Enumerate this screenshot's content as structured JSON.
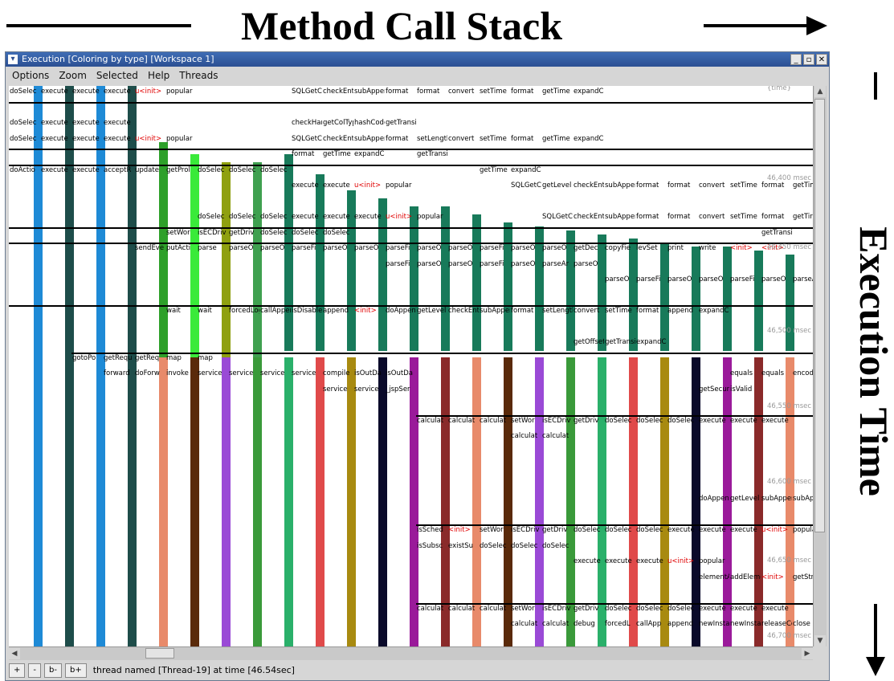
{
  "annotations": {
    "top_label": "Method Call Stack",
    "side_label": "Execution Time"
  },
  "window": {
    "title": "Execution  [Coloring by type] [Workspace 1]",
    "controls": [
      "_",
      "▫",
      "✕"
    ]
  },
  "menu": [
    "Options",
    "Zoom",
    "Selected",
    "Help",
    "Threads"
  ],
  "status": {
    "buttons": [
      "+",
      "-",
      "b-",
      "b+"
    ],
    "text": "thread named [Thread-19] at time [46.54sec]"
  },
  "time_labels": [
    "{time}",
    "46,400 msec",
    "46,450 msec",
    "46,500 msec",
    "46,550 msec",
    "46,600 msec",
    "46,650 msec",
    "46,700 msec"
  ],
  "columns": [
    {
      "color": "#1e8ad6",
      "segments": [
        [
          0,
          698
        ]
      ]
    },
    {
      "color": "#1e4d4a",
      "segments": [
        [
          0,
          698
        ]
      ]
    },
    {
      "color": "#1e8ad6",
      "segments": [
        [
          0,
          698
        ]
      ]
    },
    {
      "color": "#1e4d4a",
      "segments": [
        [
          0,
          698
        ]
      ]
    },
    {
      "color": "#2ea02a",
      "segments": [
        [
          70,
          698
        ]
      ]
    },
    {
      "color": "#3aea3a",
      "segments": [
        [
          85,
          698
        ]
      ]
    },
    {
      "color": "#8fa010",
      "segments": [
        [
          95,
          698
        ]
      ]
    },
    {
      "color": "#3fa050",
      "segments": [
        [
          95,
          400
        ]
      ]
    },
    {
      "color": "#187a5a",
      "segments": [
        [
          85,
          330
        ]
      ]
    },
    {
      "color": "#187a5a",
      "segments": [
        [
          110,
          330
        ]
      ]
    },
    {
      "color": "#187a5a",
      "segments": [
        [
          130,
          330
        ]
      ]
    },
    {
      "color": "#187a5a",
      "segments": [
        [
          140,
          330
        ]
      ]
    },
    {
      "color": "#187a5a",
      "segments": [
        [
          150,
          330
        ]
      ]
    },
    {
      "color": "#187a5a",
      "segments": [
        [
          150,
          330
        ]
      ]
    },
    {
      "color": "#187a5a",
      "segments": [
        [
          160,
          330
        ]
      ]
    },
    {
      "color": "#187a5a",
      "segments": [
        [
          170,
          330
        ]
      ]
    },
    {
      "color": "#187a5a",
      "segments": [
        [
          175,
          330
        ]
      ]
    },
    {
      "color": "#187a5a",
      "segments": [
        [
          180,
          330
        ]
      ]
    },
    {
      "color": "#187a5a",
      "segments": [
        [
          185,
          330
        ]
      ]
    },
    {
      "color": "#187a5a",
      "segments": [
        [
          190,
          330
        ]
      ]
    },
    {
      "color": "#187a5a",
      "segments": [
        [
          195,
          330
        ]
      ]
    },
    {
      "color": "#187a5a",
      "segments": [
        [
          200,
          330
        ]
      ]
    },
    {
      "color": "#187a5a",
      "segments": [
        [
          200,
          330
        ]
      ]
    },
    {
      "color": "#187a5a",
      "segments": [
        [
          205,
          330
        ]
      ]
    },
    {
      "color": "#187a5a",
      "segments": [
        [
          210,
          330
        ]
      ]
    }
  ],
  "labels": [
    {
      "t": "doSelec",
      "c": 0,
      "r": 0
    },
    {
      "t": "execute",
      "c": 1,
      "r": 0
    },
    {
      "t": "execute",
      "c": 2,
      "r": 0
    },
    {
      "t": "execute",
      "c": 3,
      "r": 0
    },
    {
      "t": "u<init>",
      "c": 4,
      "r": 0,
      "red": true
    },
    {
      "t": "popular",
      "c": 5,
      "r": 0
    },
    {
      "t": "SQLGetCol",
      "c": 9,
      "r": 0
    },
    {
      "t": "checkEntr",
      "c": 10,
      "r": 0
    },
    {
      "t": "subAppend",
      "c": 11,
      "r": 0
    },
    {
      "t": "format",
      "c": 12,
      "r": 0
    },
    {
      "t": "format",
      "c": 13,
      "r": 0
    },
    {
      "t": "convert",
      "c": 14,
      "r": 0
    },
    {
      "t": "setTime",
      "c": 15,
      "r": 0
    },
    {
      "t": "format",
      "c": 16,
      "r": 0
    },
    {
      "t": "getTime",
      "c": 17,
      "r": 0
    },
    {
      "t": "expandCaget",
      "c": 18,
      "r": 0
    },
    {
      "t": "doSelec",
      "c": 0,
      "r": 2
    },
    {
      "t": "execute",
      "c": 1,
      "r": 2
    },
    {
      "t": "execute",
      "c": 2,
      "r": 2
    },
    {
      "t": "execute",
      "c": 3,
      "r": 2
    },
    {
      "t": "checkHan",
      "c": 9,
      "r": 2
    },
    {
      "t": "getColTyp",
      "c": 10,
      "r": 2
    },
    {
      "t": "hashCode",
      "c": 11,
      "r": 2
    },
    {
      "t": "getTransi",
      "c": 12,
      "r": 2
    },
    {
      "t": "doSelec",
      "c": 0,
      "r": 3
    },
    {
      "t": "execute",
      "c": 1,
      "r": 3
    },
    {
      "t": "execute",
      "c": 2,
      "r": 3
    },
    {
      "t": "execute",
      "c": 3,
      "r": 3
    },
    {
      "t": "u<init>",
      "c": 4,
      "r": 3,
      "red": true
    },
    {
      "t": "popular",
      "c": 5,
      "r": 3
    },
    {
      "t": "SQLGetCol",
      "c": 9,
      "r": 3
    },
    {
      "t": "checkEntr",
      "c": 10,
      "r": 3
    },
    {
      "t": "subAppend",
      "c": 11,
      "r": 3
    },
    {
      "t": "format",
      "c": 12,
      "r": 3
    },
    {
      "t": "setLength",
      "c": 13,
      "r": 3
    },
    {
      "t": "convert",
      "c": 14,
      "r": 3
    },
    {
      "t": "setTime",
      "c": 15,
      "r": 3
    },
    {
      "t": "format",
      "c": 16,
      "r": 3
    },
    {
      "t": "getTime",
      "c": 17,
      "r": 3
    },
    {
      "t": "expandCaget",
      "c": 18,
      "r": 3
    },
    {
      "t": "format",
      "c": 9,
      "r": 4
    },
    {
      "t": "getTime",
      "c": 10,
      "r": 4
    },
    {
      "t": "expandCaget",
      "c": 11,
      "r": 4
    },
    {
      "t": "getTransi",
      "c": 13,
      "r": 4
    },
    {
      "t": "doActio",
      "c": 0,
      "r": 5
    },
    {
      "t": "execute",
      "c": 1,
      "r": 5
    },
    {
      "t": "execute",
      "c": 2,
      "r": 5
    },
    {
      "t": "acceptR",
      "c": 3,
      "r": 5
    },
    {
      "t": "update",
      "c": 4,
      "r": 5
    },
    {
      "t": "getProl",
      "c": 5,
      "r": 5
    },
    {
      "t": "doSelec",
      "c": 6,
      "r": 5
    },
    {
      "t": "doSelec",
      "c": 7,
      "r": 5
    },
    {
      "t": "doSelec",
      "c": 8,
      "r": 5
    },
    {
      "t": "getTime",
      "c": 15,
      "r": 5
    },
    {
      "t": "expandCaget",
      "c": 16,
      "r": 5
    },
    {
      "t": "execute",
      "c": 9,
      "r": 6
    },
    {
      "t": "execute",
      "c": 10,
      "r": 6
    },
    {
      "t": "u<init>",
      "c": 11,
      "r": 6,
      "red": true
    },
    {
      "t": "popular",
      "c": 12,
      "r": 6
    },
    {
      "t": "SQLGetCol",
      "c": 16,
      "r": 6
    },
    {
      "t": "getLevel",
      "c": 17,
      "r": 6
    },
    {
      "t": "checkEntr",
      "c": 18,
      "r": 6
    },
    {
      "t": "subAppend",
      "c": 19,
      "r": 6
    },
    {
      "t": "format",
      "c": 20,
      "r": 6
    },
    {
      "t": "format",
      "c": 21,
      "r": 6
    },
    {
      "t": "convert",
      "c": 22,
      "r": 6
    },
    {
      "t": "setTime",
      "c": 23,
      "r": 6
    },
    {
      "t": "format",
      "c": 24,
      "r": 6
    },
    {
      "t": "getTim",
      "c": 25,
      "r": 6
    },
    {
      "t": "doSelec",
      "c": 6,
      "r": 8
    },
    {
      "t": "doSelec",
      "c": 7,
      "r": 8
    },
    {
      "t": "doSelec",
      "c": 8,
      "r": 8
    },
    {
      "t": "execute",
      "c": 9,
      "r": 8
    },
    {
      "t": "execute",
      "c": 10,
      "r": 8
    },
    {
      "t": "execute",
      "c": 11,
      "r": 8
    },
    {
      "t": "u<init>",
      "c": 12,
      "r": 8,
      "red": true
    },
    {
      "t": "popular",
      "c": 13,
      "r": 8
    },
    {
      "t": "SQLGetCol",
      "c": 17,
      "r": 8
    },
    {
      "t": "checkEntr",
      "c": 18,
      "r": 8
    },
    {
      "t": "subAppend",
      "c": 19,
      "r": 8
    },
    {
      "t": "format",
      "c": 20,
      "r": 8
    },
    {
      "t": "format",
      "c": 21,
      "r": 8
    },
    {
      "t": "convert",
      "c": 22,
      "r": 8
    },
    {
      "t": "setTime",
      "c": 23,
      "r": 8
    },
    {
      "t": "format",
      "c": 24,
      "r": 8
    },
    {
      "t": "getTir",
      "c": 25,
      "r": 8
    },
    {
      "t": "setWor",
      "c": 5,
      "r": 9
    },
    {
      "t": "isECDriv",
      "c": 6,
      "r": 9
    },
    {
      "t": "getDriv",
      "c": 7,
      "r": 9
    },
    {
      "t": "doSelec",
      "c": 8,
      "r": 9
    },
    {
      "t": "doSelec",
      "c": 9,
      "r": 9
    },
    {
      "t": "doSelec",
      "c": 10,
      "r": 9
    },
    {
      "t": "getTransi",
      "c": 24,
      "r": 9
    },
    {
      "t": "sendEve",
      "c": 4,
      "r": 10
    },
    {
      "t": "putActi",
      "c": 5,
      "r": 10
    },
    {
      "t": "parse",
      "c": 6,
      "r": 10
    },
    {
      "t": "parseO",
      "c": 7,
      "r": 10
    },
    {
      "t": "parseO",
      "c": 8,
      "r": 10
    },
    {
      "t": "parseFi",
      "c": 9,
      "r": 10
    },
    {
      "t": "parseO",
      "c": 10,
      "r": 10
    },
    {
      "t": "parseO",
      "c": 11,
      "r": 10
    },
    {
      "t": "parseFi",
      "c": 12,
      "r": 10
    },
    {
      "t": "parseO",
      "c": 13,
      "r": 10
    },
    {
      "t": "parseO",
      "c": 14,
      "r": 10
    },
    {
      "t": "parseFi",
      "c": 15,
      "r": 10
    },
    {
      "t": "parseO",
      "c": 16,
      "r": 10
    },
    {
      "t": "parseO",
      "c": 17,
      "r": 10
    },
    {
      "t": "getDec",
      "c": 18,
      "r": 10
    },
    {
      "t": "copyFie",
      "c": 19,
      "r": 10
    },
    {
      "t": "levSet",
      "c": 20,
      "r": 10
    },
    {
      "t": "print",
      "c": 21,
      "r": 10
    },
    {
      "t": "write",
      "c": 22,
      "r": 10
    },
    {
      "t": "<init>",
      "c": 23,
      "r": 10,
      "red": true
    },
    {
      "t": "<init>",
      "c": 24,
      "r": 10,
      "red": true
    },
    {
      "t": "parseFi",
      "c": 12,
      "r": 11
    },
    {
      "t": "parseO",
      "c": 13,
      "r": 11
    },
    {
      "t": "parseO",
      "c": 14,
      "r": 11
    },
    {
      "t": "parseFi",
      "c": 15,
      "r": 11
    },
    {
      "t": "parseO",
      "c": 16,
      "r": 11
    },
    {
      "t": "parseAr",
      "c": 17,
      "r": 11
    },
    {
      "t": "parseO",
      "c": 18,
      "r": 11
    },
    {
      "t": "parseO",
      "c": 19,
      "r": 12
    },
    {
      "t": "parseFi",
      "c": 20,
      "r": 12
    },
    {
      "t": "parseO",
      "c": 21,
      "r": 12
    },
    {
      "t": "parseO",
      "c": 22,
      "r": 12
    },
    {
      "t": "parseFi",
      "c": 23,
      "r": 12
    },
    {
      "t": "parseO",
      "c": 24,
      "r": 12
    },
    {
      "t": "parseA",
      "c": 25,
      "r": 12
    },
    {
      "t": "wait",
      "c": 5,
      "r": 14
    },
    {
      "t": "wait",
      "c": 6,
      "r": 14
    },
    {
      "t": "forcedLog",
      "c": 7,
      "r": 14
    },
    {
      "t": "callAppen",
      "c": 8,
      "r": 14
    },
    {
      "t": "isDisable",
      "c": 9,
      "r": 14
    },
    {
      "t": "append",
      "c": 10,
      "r": 14
    },
    {
      "t": "<init>",
      "c": 11,
      "r": 14,
      "red": true
    },
    {
      "t": "doAppend",
      "c": 12,
      "r": 14
    },
    {
      "t": "getLevel",
      "c": 13,
      "r": 14
    },
    {
      "t": "checkEntr",
      "c": 14,
      "r": 14
    },
    {
      "t": "subAppend",
      "c": 15,
      "r": 14
    },
    {
      "t": "format",
      "c": 16,
      "r": 14
    },
    {
      "t": "setLength",
      "c": 17,
      "r": 14
    },
    {
      "t": "convert",
      "c": 18,
      "r": 14
    },
    {
      "t": "setTime",
      "c": 19,
      "r": 14
    },
    {
      "t": "format",
      "c": 20,
      "r": 14
    },
    {
      "t": "append",
      "c": 21,
      "r": 14
    },
    {
      "t": "expandCaget",
      "c": 22,
      "r": 14
    },
    {
      "t": "getOffset",
      "c": 18,
      "r": 16
    },
    {
      "t": "getTransi",
      "c": 19,
      "r": 16
    },
    {
      "t": "expandCaget",
      "c": 20,
      "r": 16
    },
    {
      "t": "gotoPo",
      "c": 2,
      "r": 17
    },
    {
      "t": "getRequ",
      "c": 3,
      "r": 17
    },
    {
      "t": "getReq",
      "c": 4,
      "r": 17
    },
    {
      "t": "map",
      "c": 5,
      "r": 17
    },
    {
      "t": "map",
      "c": 6,
      "r": 17
    },
    {
      "t": "forward",
      "c": 3,
      "r": 18
    },
    {
      "t": "doForw",
      "c": 4,
      "r": 18
    },
    {
      "t": "invoke",
      "c": 5,
      "r": 18
    },
    {
      "t": "service",
      "c": 6,
      "r": 18
    },
    {
      "t": "service",
      "c": 7,
      "r": 18
    },
    {
      "t": "service",
      "c": 8,
      "r": 18
    },
    {
      "t": "service",
      "c": 9,
      "r": 18
    },
    {
      "t": "compile",
      "c": 10,
      "r": 18
    },
    {
      "t": "isOutDa",
      "c": 11,
      "r": 18
    },
    {
      "t": "isOutDa",
      "c": 12,
      "r": 18
    },
    {
      "t": "equals",
      "c": 23,
      "r": 18
    },
    {
      "t": "equals",
      "c": 24,
      "r": 18
    },
    {
      "t": "encod",
      "c": 25,
      "r": 18
    },
    {
      "t": "service",
      "c": 10,
      "r": 19
    },
    {
      "t": "service",
      "c": 11,
      "r": 19
    },
    {
      "t": "_jspSer",
      "c": 12,
      "r": 19
    },
    {
      "t": "getSecuri",
      "c": 22,
      "r": 19
    },
    {
      "t": "isValid",
      "c": 23,
      "r": 19
    },
    {
      "t": "calculat",
      "c": 13,
      "r": 21
    },
    {
      "t": "calculat",
      "c": 14,
      "r": 21
    },
    {
      "t": "calculat",
      "c": 15,
      "r": 21
    },
    {
      "t": "setWor",
      "c": 16,
      "r": 21
    },
    {
      "t": "isECDriv",
      "c": 17,
      "r": 21
    },
    {
      "t": "getDriv",
      "c": 18,
      "r": 21
    },
    {
      "t": "doSelec",
      "c": 19,
      "r": 21
    },
    {
      "t": "doSelec",
      "c": 20,
      "r": 21
    },
    {
      "t": "doSelec",
      "c": 21,
      "r": 21
    },
    {
      "t": "execute",
      "c": 22,
      "r": 21
    },
    {
      "t": "execute",
      "c": 23,
      "r": 21
    },
    {
      "t": "execute",
      "c": 24,
      "r": 21
    },
    {
      "t": "calculat",
      "c": 16,
      "r": 22
    },
    {
      "t": "calculat",
      "c": 17,
      "r": 22
    },
    {
      "t": "doAppend",
      "c": 22,
      "r": 26
    },
    {
      "t": "getLevel",
      "c": 23,
      "r": 26
    },
    {
      "t": "subAppend",
      "c": 24,
      "r": 26
    },
    {
      "t": "subAp",
      "c": 25,
      "r": 26
    },
    {
      "t": "isSched",
      "c": 13,
      "r": 28
    },
    {
      "t": "<init>",
      "c": 14,
      "r": 28,
      "red": true
    },
    {
      "t": "setWor",
      "c": 15,
      "r": 28
    },
    {
      "t": "isECDriv",
      "c": 16,
      "r": 28
    },
    {
      "t": "getDriv",
      "c": 17,
      "r": 28
    },
    {
      "t": "doSelec",
      "c": 18,
      "r": 28
    },
    {
      "t": "doSelec",
      "c": 19,
      "r": 28
    },
    {
      "t": "doSelec",
      "c": 20,
      "r": 28
    },
    {
      "t": "execute",
      "c": 21,
      "r": 28
    },
    {
      "t": "execute",
      "c": 22,
      "r": 28
    },
    {
      "t": "execute",
      "c": 23,
      "r": 28
    },
    {
      "t": "u<init>",
      "c": 24,
      "r": 28,
      "red": true
    },
    {
      "t": "popular",
      "c": 25,
      "r": 28
    },
    {
      "t": "isSubsc",
      "c": 13,
      "r": 29
    },
    {
      "t": "existSu",
      "c": 14,
      "r": 29
    },
    {
      "t": "doSelec",
      "c": 15,
      "r": 29
    },
    {
      "t": "doSelec",
      "c": 16,
      "r": 29
    },
    {
      "t": "doSelec",
      "c": 17,
      "r": 29
    },
    {
      "t": "execute",
      "c": 18,
      "r": 30
    },
    {
      "t": "execute",
      "c": 19,
      "r": 30
    },
    {
      "t": "execute",
      "c": 20,
      "r": 30
    },
    {
      "t": "u<init>",
      "c": 21,
      "r": 30,
      "red": true
    },
    {
      "t": "popular",
      "c": 22,
      "r": 30
    },
    {
      "t": "elementAt",
      "c": 22,
      "r": 31
    },
    {
      "t": "addElemen",
      "c": 23,
      "r": 31
    },
    {
      "t": "<init>",
      "c": 24,
      "r": 31,
      "red": true
    },
    {
      "t": "getStr",
      "c": 25,
      "r": 31
    },
    {
      "t": "calculat",
      "c": 13,
      "r": 33
    },
    {
      "t": "calculat",
      "c": 14,
      "r": 33
    },
    {
      "t": "calculat",
      "c": 15,
      "r": 33
    },
    {
      "t": "setWor",
      "c": 16,
      "r": 33
    },
    {
      "t": "isECDriv",
      "c": 17,
      "r": 33
    },
    {
      "t": "getDriv",
      "c": 18,
      "r": 33
    },
    {
      "t": "doSelec",
      "c": 19,
      "r": 33
    },
    {
      "t": "doSelec",
      "c": 20,
      "r": 33
    },
    {
      "t": "doSelec",
      "c": 21,
      "r": 33
    },
    {
      "t": "execute",
      "c": 22,
      "r": 33
    },
    {
      "t": "execute",
      "c": 23,
      "r": 33
    },
    {
      "t": "execute",
      "c": 24,
      "r": 33
    },
    {
      "t": "calculat",
      "c": 16,
      "r": 34
    },
    {
      "t": "calculat",
      "c": 17,
      "r": 34
    },
    {
      "t": "debug",
      "c": 18,
      "r": 34
    },
    {
      "t": "forcedL",
      "c": 19,
      "r": 34
    },
    {
      "t": "callApp",
      "c": 20,
      "r": 34
    },
    {
      "t": "append",
      "c": 21,
      "r": 34
    },
    {
      "t": "newInstan",
      "c": 22,
      "r": 34
    },
    {
      "t": "newInstan",
      "c": 23,
      "r": 34
    },
    {
      "t": "releaseCo",
      "c": 24,
      "r": 34
    },
    {
      "t": "close",
      "c": 25,
      "r": 34
    }
  ]
}
